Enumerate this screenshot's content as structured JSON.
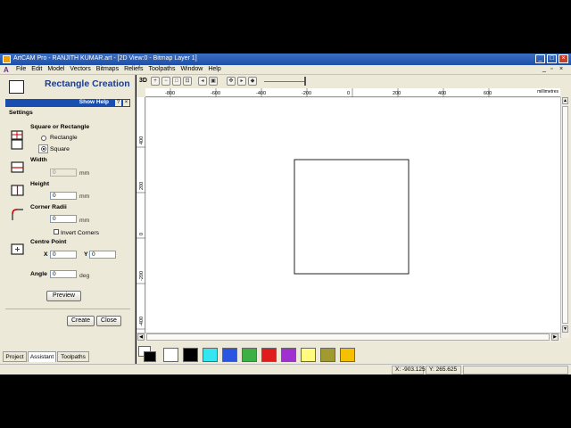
{
  "window": {
    "title": "ArtCAM Pro - RANJITH KUMAR.art - [2D View:0 - Bitmap Layer 1]",
    "controls": [
      "_",
      "□",
      "×"
    ]
  },
  "menu": [
    "File",
    "Edit",
    "Model",
    "Vectors",
    "Bitmaps",
    "Reliefs",
    "Toolpaths",
    "Window",
    "Help"
  ],
  "panel": {
    "title": "Rectangle Creation",
    "help_label": "Show Help",
    "settings_label": "Settings",
    "shape_label": "Square or Rectangle",
    "shape_options": [
      "Rectangle",
      "Square"
    ],
    "shape_selected": "Square",
    "width_label": "Width",
    "width_value": "0",
    "height_label": "Height",
    "height_value": "0",
    "corner_label": "Corner Radii",
    "corner_value": "0",
    "invert_label": "Invert Corners",
    "centre_label": "Centre Point",
    "x_label": "X",
    "x_value": "0",
    "y_label": "Y",
    "y_value": "0",
    "angle_label": "Angle",
    "angle_value": "0",
    "unit_mm": "mm",
    "unit_deg": "deg",
    "preview_label": "Preview",
    "create_label": "Create",
    "close_label": "Close",
    "tabs": [
      "Project",
      "Assistant",
      "Toolpaths"
    ],
    "active_tab": "Assistant"
  },
  "view": {
    "mode_label": "3D",
    "ruler_unit": "millimetres",
    "ruler_x_ticks": [
      "-800",
      "-600",
      "-400",
      "-200",
      "0",
      "200",
      "400",
      "600"
    ],
    "ruler_y_ticks": [
      "400",
      "200",
      "0",
      "-200",
      "-400"
    ]
  },
  "palette": {
    "colors": [
      "#ffffff",
      "#000000",
      "#33e6f0",
      "#2a55e0",
      "#3cb044",
      "#e01c1c",
      "#a030d0",
      "#fffc80",
      "#a09a30",
      "#f5c000"
    ]
  },
  "status": {
    "x_readout": "X: -903.125",
    "y_readout": "Y: 265.625"
  }
}
